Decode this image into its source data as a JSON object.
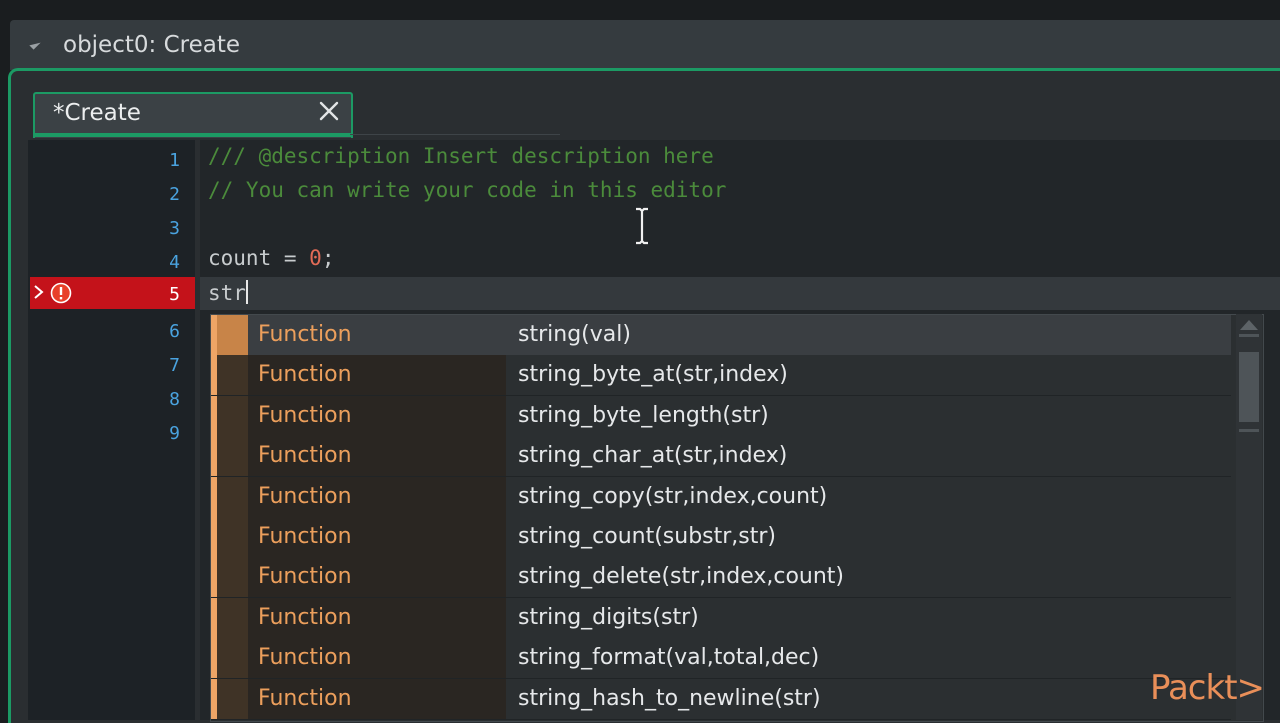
{
  "window": {
    "title": "object0: Create"
  },
  "tab": {
    "label": "*Create",
    "close_icon": "close-icon"
  },
  "gutter": {
    "line_numbers": [
      "1",
      "2",
      "3",
      "4",
      "5",
      "6",
      "7",
      "8",
      "9"
    ],
    "error_line": "5"
  },
  "code": {
    "line1": "/// @description Insert description here",
    "line2": "// You can write your code in this editor",
    "line4_ident": "count",
    "line4_op": " = ",
    "line4_num": "0",
    "line4_end": ";",
    "line5": "str"
  },
  "autocomplete": {
    "items": [
      {
        "category": "Function",
        "signature": "string(val)"
      },
      {
        "category": "Function",
        "signature": "string_byte_at(str,index)"
      },
      {
        "category": "Function",
        "signature": "string_byte_length(str)"
      },
      {
        "category": "Function",
        "signature": "string_char_at(str,index)"
      },
      {
        "category": "Function",
        "signature": "string_copy(str,index,count)"
      },
      {
        "category": "Function",
        "signature": "string_count(substr,str)"
      },
      {
        "category": "Function",
        "signature": "string_delete(str,index,count)"
      },
      {
        "category": "Function",
        "signature": "string_digits(str)"
      },
      {
        "category": "Function",
        "signature": "string_format(val,total,dec)"
      },
      {
        "category": "Function",
        "signature": "string_hash_to_newline(str)"
      }
    ],
    "selected_index": 0
  },
  "watermark": "Packt>",
  "colors": {
    "accent": "#1c9a64",
    "error": "#c4121a",
    "comment": "#4b8b3b",
    "number": "#e26b56",
    "function_category": "#ec9f5c"
  }
}
